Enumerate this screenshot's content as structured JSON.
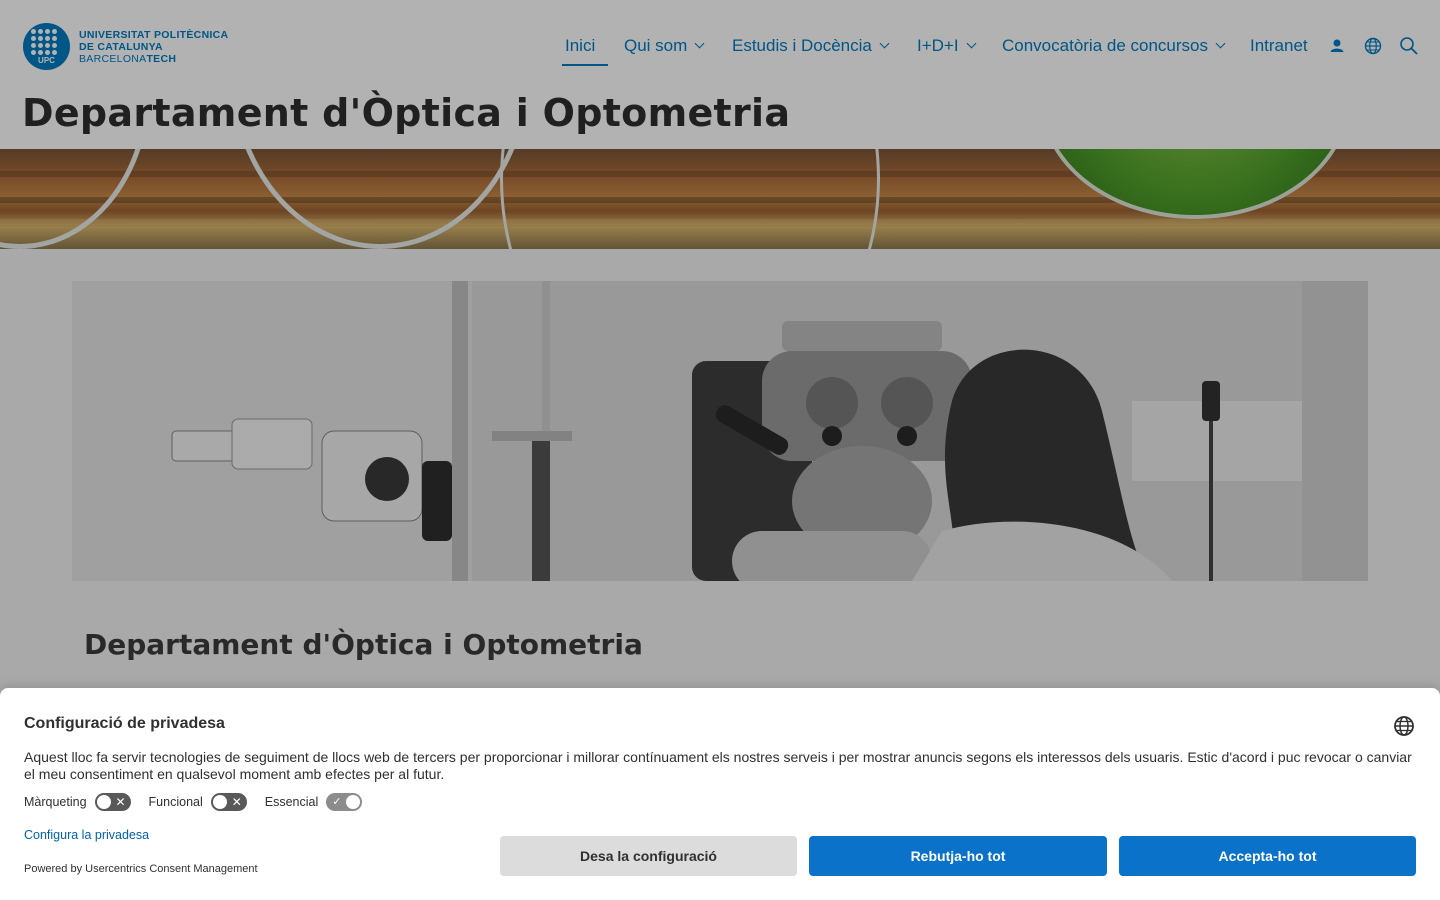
{
  "logo": {
    "badge": "UPC",
    "line1": "UNIVERSITAT POLITÈCNICA",
    "line2": "DE CATALUNYA",
    "line3_light": "BARCELONA",
    "line3_bold": "TECH"
  },
  "nav": {
    "items": [
      {
        "label": "Inici",
        "active": true
      },
      {
        "label": "Qui som",
        "dropdown": true
      },
      {
        "label": "Estudis i Docència",
        "dropdown": true
      },
      {
        "label": "I+D+I",
        "dropdown": true
      },
      {
        "label": "Convocatòria de concursos",
        "dropdown": true
      },
      {
        "label": "Intranet"
      }
    ],
    "icons": [
      "user-icon",
      "globe-icon",
      "search-icon"
    ]
  },
  "page": {
    "title_light": "Departament d'",
    "title_bold": "Òptica i Optometria",
    "section_title": "Departament d'Òptica i Optometria"
  },
  "consent": {
    "title": "Configuració de privadesa",
    "text": "Aquest lloc fa servir tecnologies de seguiment de llocs web de tercers per proporcionar i millorar contínuament els nostres serveis i per mostrar anuncis segons els interessos dels usuaris. Estic d'acord i puc revocar o canviar el meu consentiment en qualsevol moment amb efectes per al futur.",
    "toggles": [
      {
        "label": "Màrqueting",
        "on": false
      },
      {
        "label": "Funcional",
        "on": false
      },
      {
        "label": "Essencial",
        "on": true
      }
    ],
    "config_link": "Configura la privadesa",
    "powered_by": "Powered by Usercentrics Consent Management",
    "buttons": {
      "save": "Desa la configuració",
      "reject": "Rebutja-ho tot",
      "accept": "Accepta-ho tot"
    }
  },
  "colors": {
    "brand": "#007bc0",
    "button_primary": "#0a72c9",
    "button_secondary": "#dcdcdc"
  }
}
